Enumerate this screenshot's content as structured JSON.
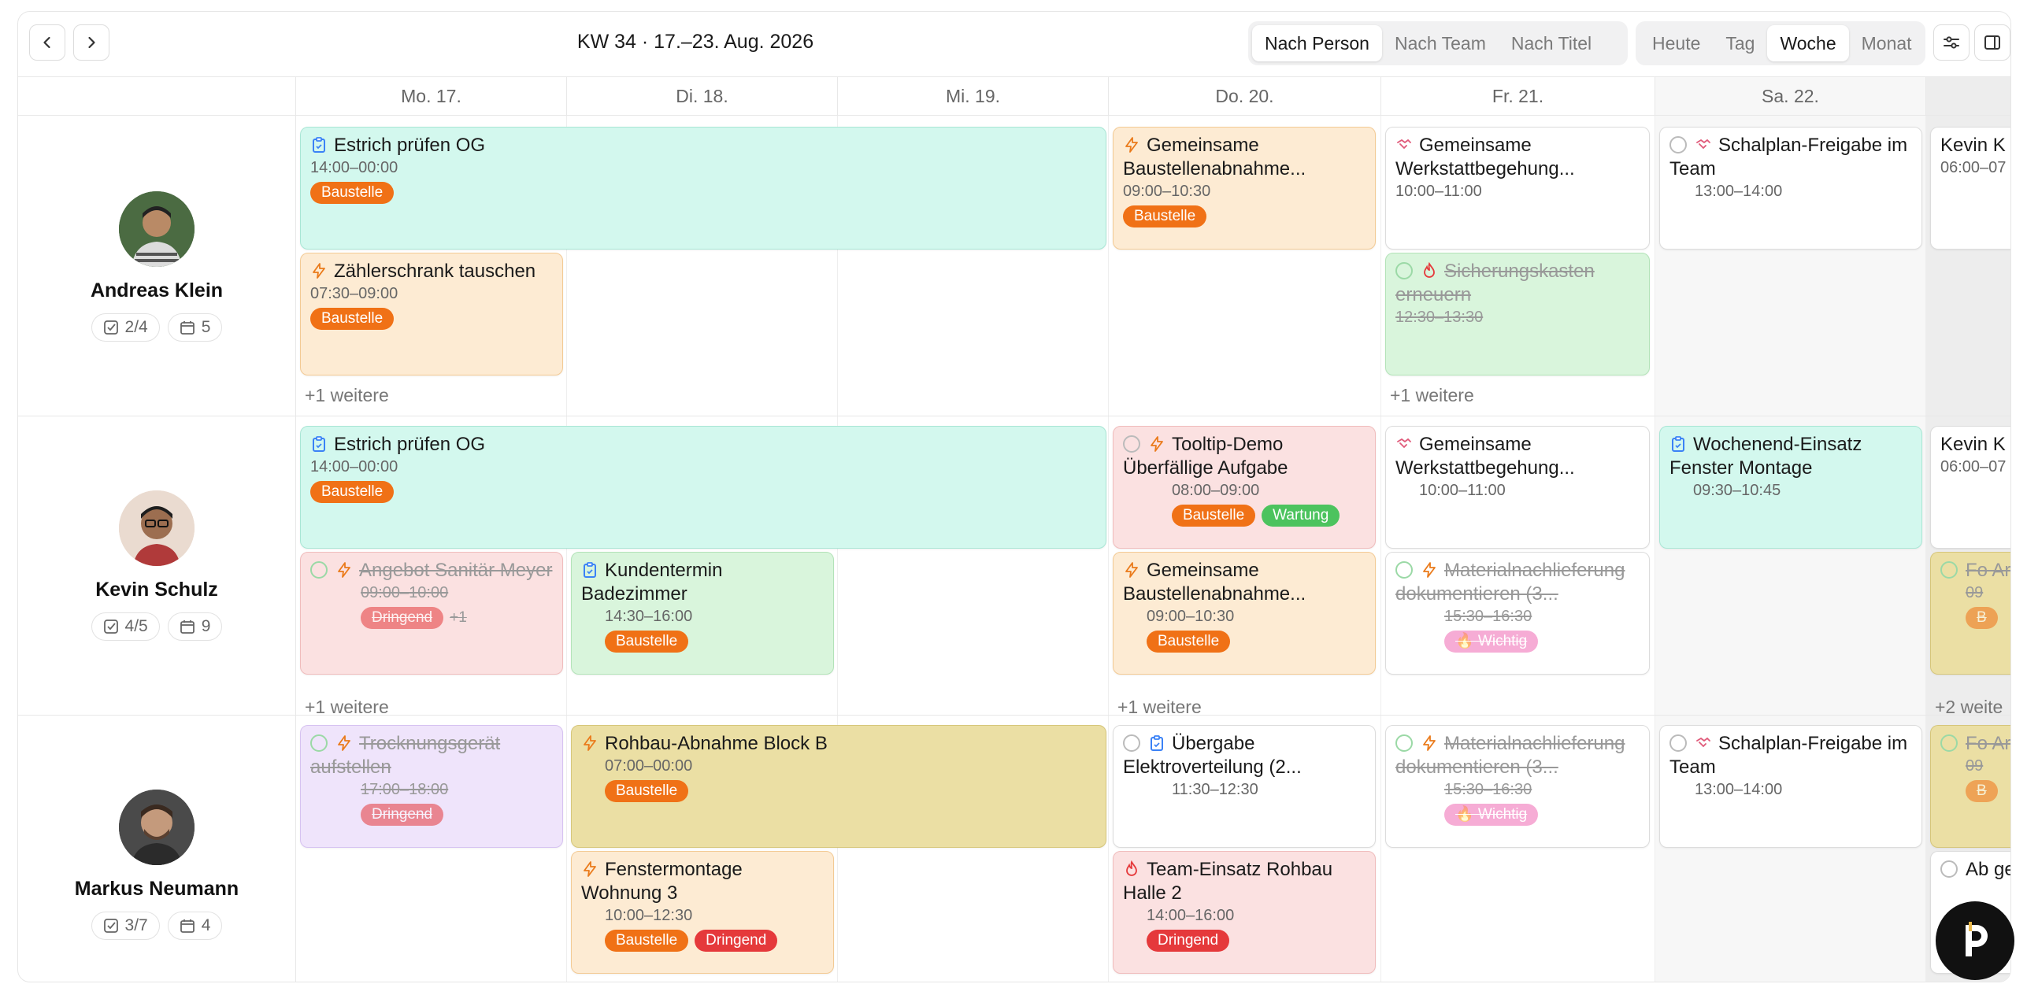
{
  "toolbar": {
    "prev_icon": "chevron-left-icon",
    "next_icon": "chevron-right-icon",
    "week_title": "KW 34 · 17.–23. Aug. 2026",
    "group_modes": [
      "Nach Person",
      "Nach Team",
      "Nach Titel"
    ],
    "group_active": "Nach Person",
    "views": [
      "Heute",
      "Tag",
      "Woche",
      "Monat"
    ],
    "view_active": "Woche",
    "filter_icon": "sliders-icon",
    "panel_icon": "sidebar-panel-icon"
  },
  "days": [
    "Mo. 17.",
    "Di. 18.",
    "Mi. 19.",
    "Do. 20.",
    "Fr. 21.",
    "Sa. 22."
  ],
  "people": [
    {
      "name": "Andreas Klein",
      "tasks": "2/4",
      "events": "5",
      "more": "+1 weitere",
      "more2": "+1 weitere"
    },
    {
      "name": "Kevin Schulz",
      "tasks": "4/5",
      "events": "9",
      "more": "+1 weitere",
      "more2": "+1 weitere",
      "more3": "+2 weite"
    },
    {
      "name": "Markus Neumann",
      "tasks": "3/7",
      "events": "4"
    }
  ],
  "events": {
    "a1": {
      "title": "Estrich prüfen OG",
      "time": "14:00–00:00",
      "tag": "Baustelle"
    },
    "a2": {
      "title": "Zählerschrank tauschen",
      "time": "07:30–09:00",
      "tag": "Baustelle"
    },
    "a3": {
      "title": "Gemeinsame Baustellenabnahme...",
      "time": "09:00–10:30",
      "tag": "Baustelle"
    },
    "a4": {
      "title": "Gemeinsame Werkstattbegehung...",
      "time": "10:00–11:00"
    },
    "a5": {
      "title": "Sicherungskasten erneuern",
      "time": "12:30–13:30"
    },
    "a6": {
      "title": "Schalplan-Freigabe im Team",
      "time": "13:00–14:00"
    },
    "a7": {
      "title": "Kevin K",
      "time": "06:00–07"
    },
    "k1": {
      "title": "Estrich prüfen OG",
      "time": "14:00–00:00",
      "tag": "Baustelle"
    },
    "k2": {
      "title": "Angebot Sanitär Meyer",
      "time": "09:00–10:00",
      "tag": "Dringend",
      "extra": "+1"
    },
    "k3": {
      "title": "Kundentermin Badezimmer",
      "time": "14:30–16:00",
      "tag": "Baustelle"
    },
    "k4": {
      "title": "Tooltip-Demo Überfällige Aufgabe",
      "time": "08:00–09:00",
      "tag": "Baustelle",
      "tag2": "Wartung"
    },
    "k5": {
      "title": "Gemeinsame Baustellenabnahme...",
      "time": "09:00–10:30",
      "tag": "Baustelle"
    },
    "k6": {
      "title": "Gemeinsame Werkstattbegehung...",
      "time": "10:00–11:00"
    },
    "k7": {
      "title": "Materialnachlieferung dokumentieren (3...",
      "time": "15:30–16:30",
      "tag": "🔥 Wichtig"
    },
    "k8": {
      "title": "Wochenend-Einsatz Fenster Montage",
      "time": "09:30–10:45"
    },
    "k9": {
      "title": "Kevin K",
      "time": "06:00–07"
    },
    "k10": {
      "title": "Fo Ar",
      "time": "09",
      "tag": "B"
    },
    "m1": {
      "title": "Trocknungsgerät aufstellen",
      "time": "17:00–18:00",
      "tag": "Dringend"
    },
    "m2": {
      "title": "Rohbau-Abnahme Block B",
      "time": "07:00–00:00",
      "tag": "Baustelle"
    },
    "m3": {
      "title": "Fenstermontage Wohnung 3",
      "time": "10:00–12:30",
      "tag": "Baustelle",
      "tag2": "Dringend"
    },
    "m4": {
      "title": "Übergabe Elektroverteilung (2...",
      "time": "11:30–12:30"
    },
    "m5": {
      "title": "Team-Einsatz Rohbau Halle 2",
      "time": "14:00–16:00",
      "tag": "Dringend"
    },
    "m6": {
      "title": "Materialnachlieferung dokumentieren (3...",
      "time": "15:30–16:30",
      "tag": "🔥 Wichtig"
    },
    "m7": {
      "title": "Schalplan-Freigabe im Team",
      "time": "13:00–14:00"
    },
    "m8": {
      "title": "Fo Ar",
      "time": "09",
      "tag": "B"
    },
    "m9": {
      "title": "Ab ge"
    }
  },
  "colors": {
    "baustelle": "#f07116",
    "dringend": "#e5393b",
    "wartung": "#4cc35e",
    "wichtig": "#f06ab4"
  }
}
